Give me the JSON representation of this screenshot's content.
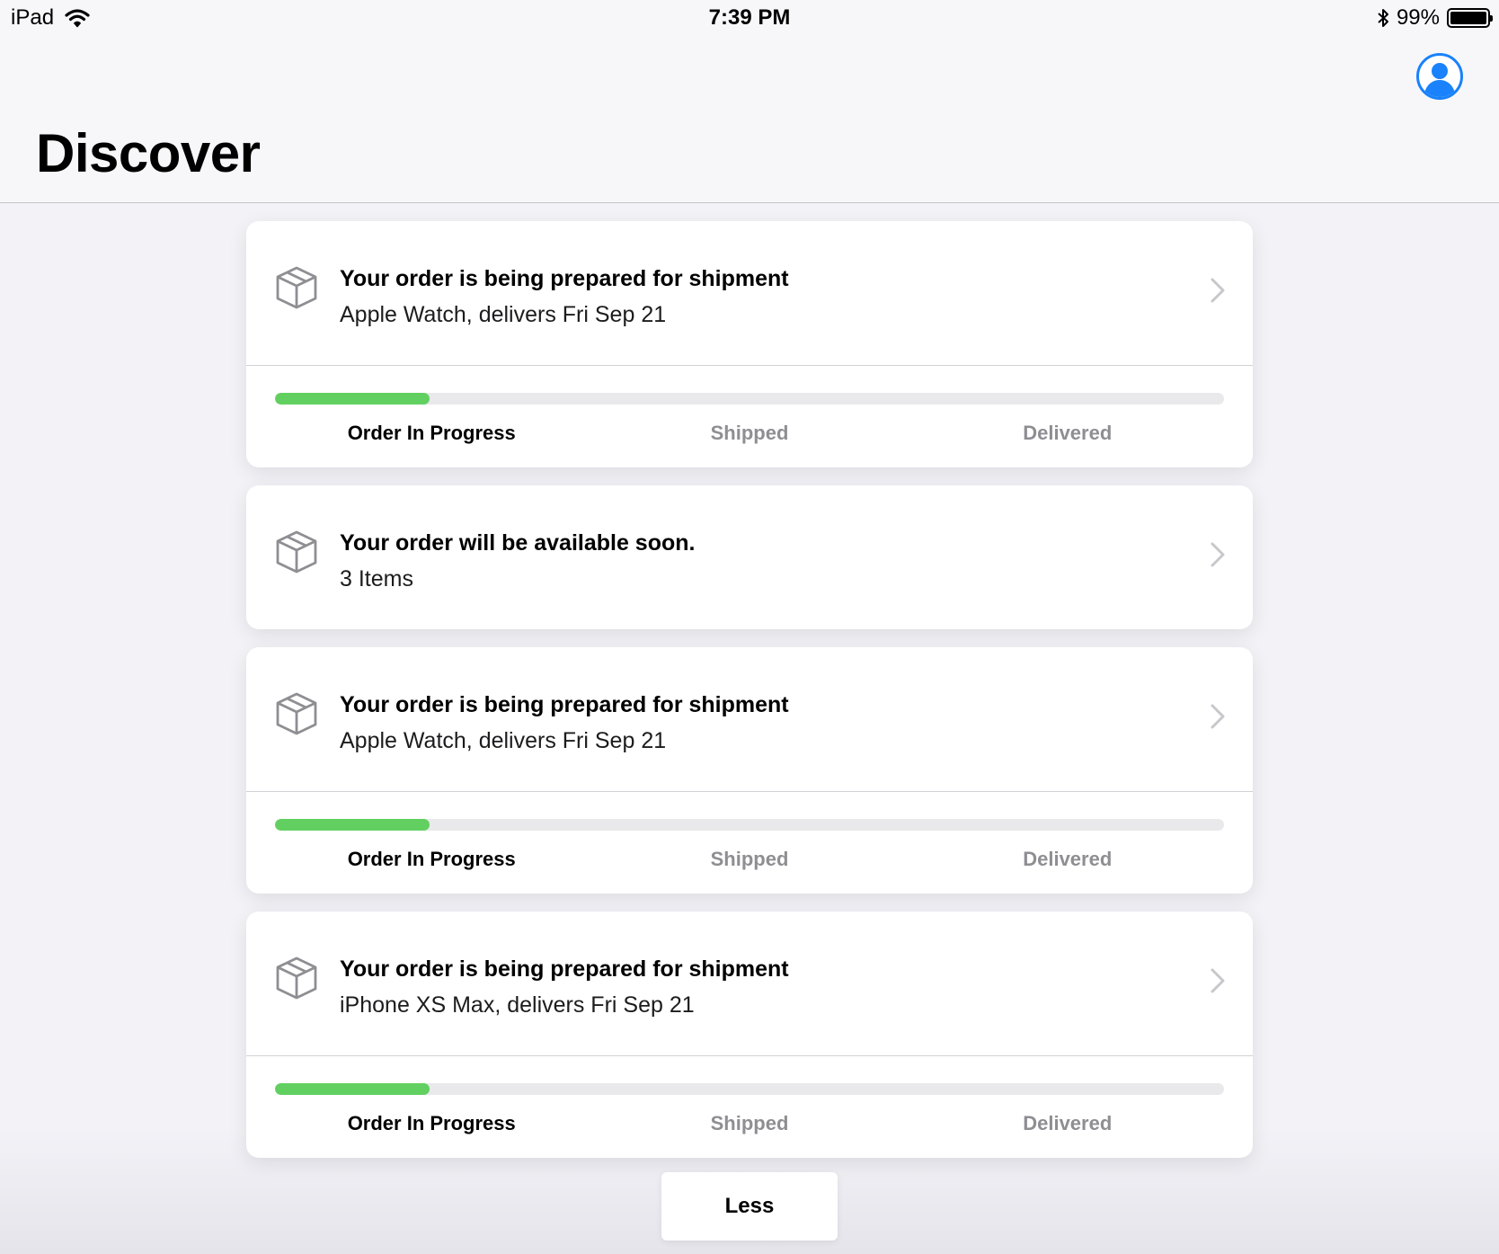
{
  "status_bar": {
    "device": "iPad",
    "time": "7:39 PM",
    "battery_percent": "99%",
    "battery_level": 0.99,
    "icons": [
      "wifi-icon",
      "bluetooth-icon",
      "battery-icon"
    ]
  },
  "header": {
    "title": "Discover",
    "account_icon": "person-circle-icon"
  },
  "colors": {
    "accent": "#1a82fb",
    "progress": "#62d060",
    "track": "#e9e9eb",
    "inactive_text": "#8e8e93"
  },
  "cards": [
    {
      "title": "Your order is being prepared for shipment",
      "subtitle": "Apple Watch, delivers Fri Sep 21",
      "icon": "package-box-icon",
      "progress": 0.163,
      "steps": [
        "Order In Progress",
        "Shipped",
        "Delivered"
      ],
      "active_step": 0
    },
    {
      "title": "Your order will be available soon.",
      "subtitle": "3 Items",
      "icon": "package-box-icon"
    },
    {
      "title": "Your order is being prepared for shipment",
      "subtitle": "Apple Watch, delivers Fri Sep 21",
      "icon": "package-box-icon",
      "progress": 0.163,
      "steps": [
        "Order In Progress",
        "Shipped",
        "Delivered"
      ],
      "active_step": 0
    },
    {
      "title": "Your order is being prepared for shipment",
      "subtitle": "iPhone XS Max, delivers Fri Sep 21",
      "icon": "package-box-icon",
      "progress": 0.163,
      "steps": [
        "Order In Progress",
        "Shipped",
        "Delivered"
      ],
      "active_step": 0
    }
  ],
  "less_button": "Less"
}
